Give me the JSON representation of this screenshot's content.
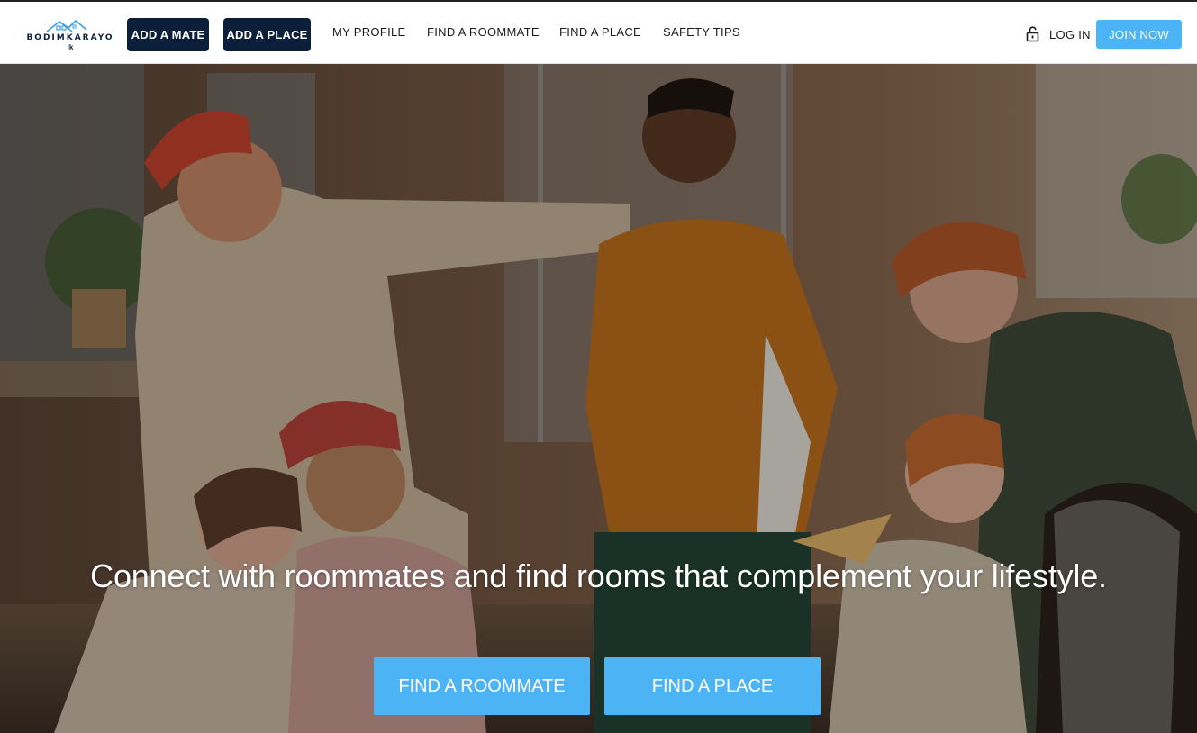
{
  "header": {
    "logo": {
      "brand": "BODIMKARAYO",
      "suffix": "lk",
      "icon": "house-icon"
    },
    "add_mate_label": "ADD A MATE",
    "add_place_label": "ADD A PLACE",
    "nav": {
      "my_profile": "MY PROFILE",
      "find_roommate": "FIND A ROOMMATE",
      "find_place": "FIND A PLACE",
      "safety_tips": "SAFETY TIPS"
    },
    "login_label": "LOG IN",
    "login_icon": "unlock-icon",
    "join_label": "JOIN NOW"
  },
  "hero": {
    "tagline": "Connect with roommates and find rooms that complement your lifestyle.",
    "find_roommate_label": "FIND A ROOMMATE",
    "find_place_label": "FIND A PLACE"
  },
  "colors": {
    "navy": "#0b1f3a",
    "accent_blue": "#4cb3f5",
    "white": "#ffffff"
  }
}
